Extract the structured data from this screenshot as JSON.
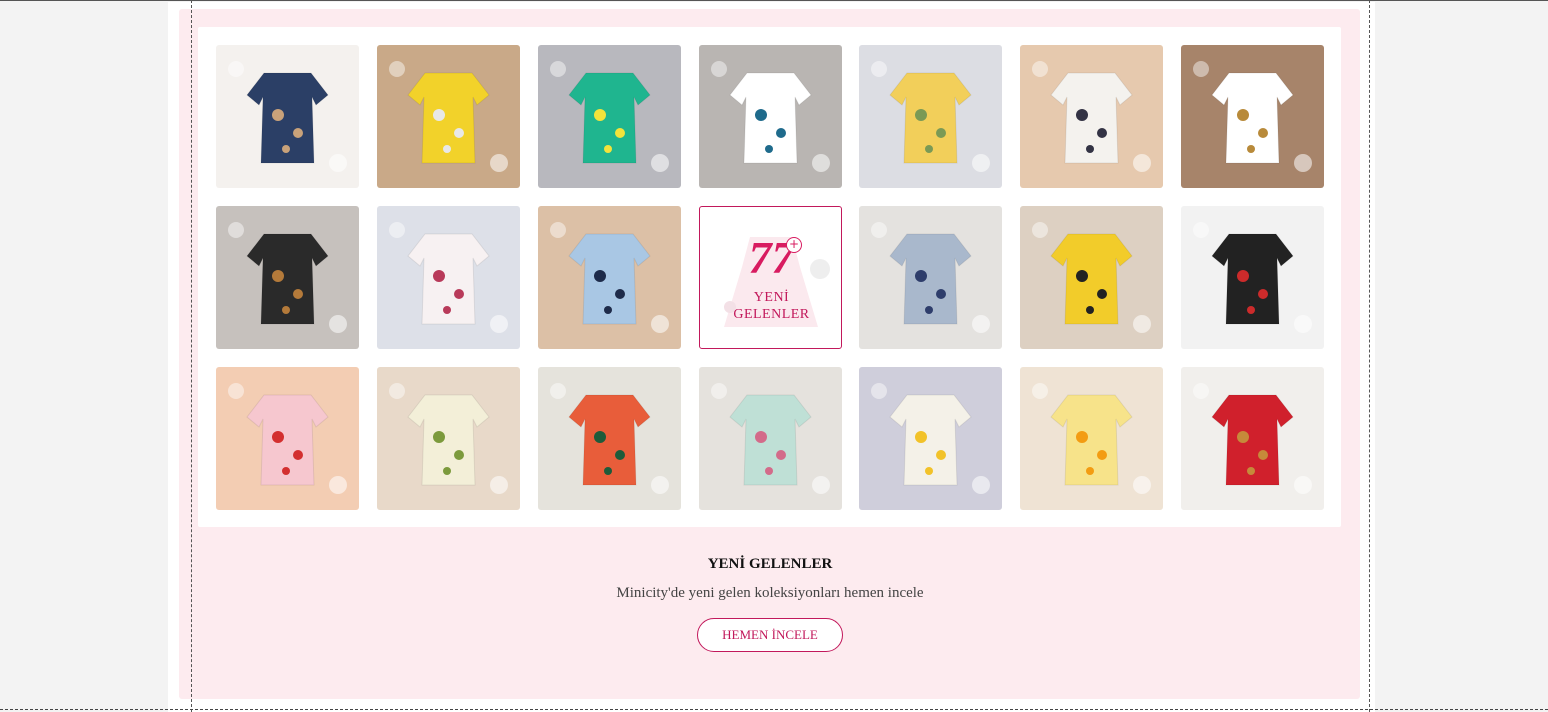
{
  "promo_tile": {
    "number": "77",
    "plus": "+",
    "caption_line1": "YENİ",
    "caption_line2": "GELENLER"
  },
  "section": {
    "title": "YENİ GELENLER",
    "subtitle": "Minicity'de yeni gelen koleksiyonları hemen incele",
    "button_label": "HEMEN İNCELE"
  },
  "product_images": [
    {
      "name": "denim-dog-overall",
      "bg": "#f4f1ee",
      "main": "#2b3f66",
      "accent": "#c9a27a"
    },
    {
      "name": "yellow-dot-dress",
      "bg": "#c9a988",
      "main": "#f2d22a",
      "accent": "#e8e8e8"
    },
    {
      "name": "not-interested-set",
      "bg": "#b8b8be",
      "main": "#1fb58f",
      "accent": "#f3e33b"
    },
    {
      "name": "happy-birthday-bodysuit",
      "bg": "#b9b5b2",
      "main": "#ffffff",
      "accent": "#1f6b8c"
    },
    {
      "name": "little-miss-sassy-set",
      "bg": "#dcdde3",
      "main": "#f2cf5a",
      "accent": "#7a9a55"
    },
    {
      "name": "gentleman-romper",
      "bg": "#e6c9ae",
      "main": "#f4f2ee",
      "accent": "#334"
    },
    {
      "name": "floral-pants-set",
      "bg": "#a7846a",
      "main": "#ffffff",
      "accent": "#b88a3a"
    },
    {
      "name": "striped-fox-set",
      "bg": "#c6c1bd",
      "main": "#2a2a2a",
      "accent": "#b47a3a"
    },
    {
      "name": "rose-print-jumpsuit",
      "bg": "#dde0e8",
      "main": "#f7f1f2",
      "accent": "#b83a5a"
    },
    {
      "name": "blue-stripe-romper",
      "bg": "#dcc0a6",
      "main": "#a9c7e4",
      "accent": "#1e2b4a"
    },
    {
      "name": "promo",
      "bg": "#ffffff",
      "main": "#f7d7e0",
      "accent": "#d81b60"
    },
    {
      "name": "blue-floral-romper",
      "bg": "#e4e2df",
      "main": "#a9b8cc",
      "accent": "#2e3d6b"
    },
    {
      "name": "elephant-hoodie-set",
      "bg": "#ddd0c2",
      "main": "#f2cc2a",
      "accent": "#222"
    },
    {
      "name": "milestone-blanket",
      "bg": "#f2f2f2",
      "main": "#222",
      "accent": "#cc2b2b"
    },
    {
      "name": "i-love-mom-bodysuit",
      "bg": "#f3cdb3",
      "main": "#f6c7cf",
      "accent": "#d32f2f"
    },
    {
      "name": "lemon-floral-romper",
      "bg": "#e8d9c9",
      "main": "#f3efd8",
      "accent": "#7c9a3c"
    },
    {
      "name": "floral-top-green-shorts",
      "bg": "#e5e3dc",
      "main": "#e85d3a",
      "accent": "#1d5b3a"
    },
    {
      "name": "mint-floral-romper",
      "bg": "#e5e2dd",
      "main": "#bfe0d6",
      "accent": "#d36b8a"
    },
    {
      "name": "bee-stripe-overall",
      "bg": "#cfcedb",
      "main": "#f4f1e8",
      "accent": "#f2c229"
    },
    {
      "name": "sunflower-romper",
      "bg": "#efe3d4",
      "main": "#f7e38a",
      "accent": "#f39c12"
    },
    {
      "name": "red-floral-dress",
      "bg": "#f1efec",
      "main": "#d0202c",
      "accent": "#c68a3a"
    }
  ]
}
